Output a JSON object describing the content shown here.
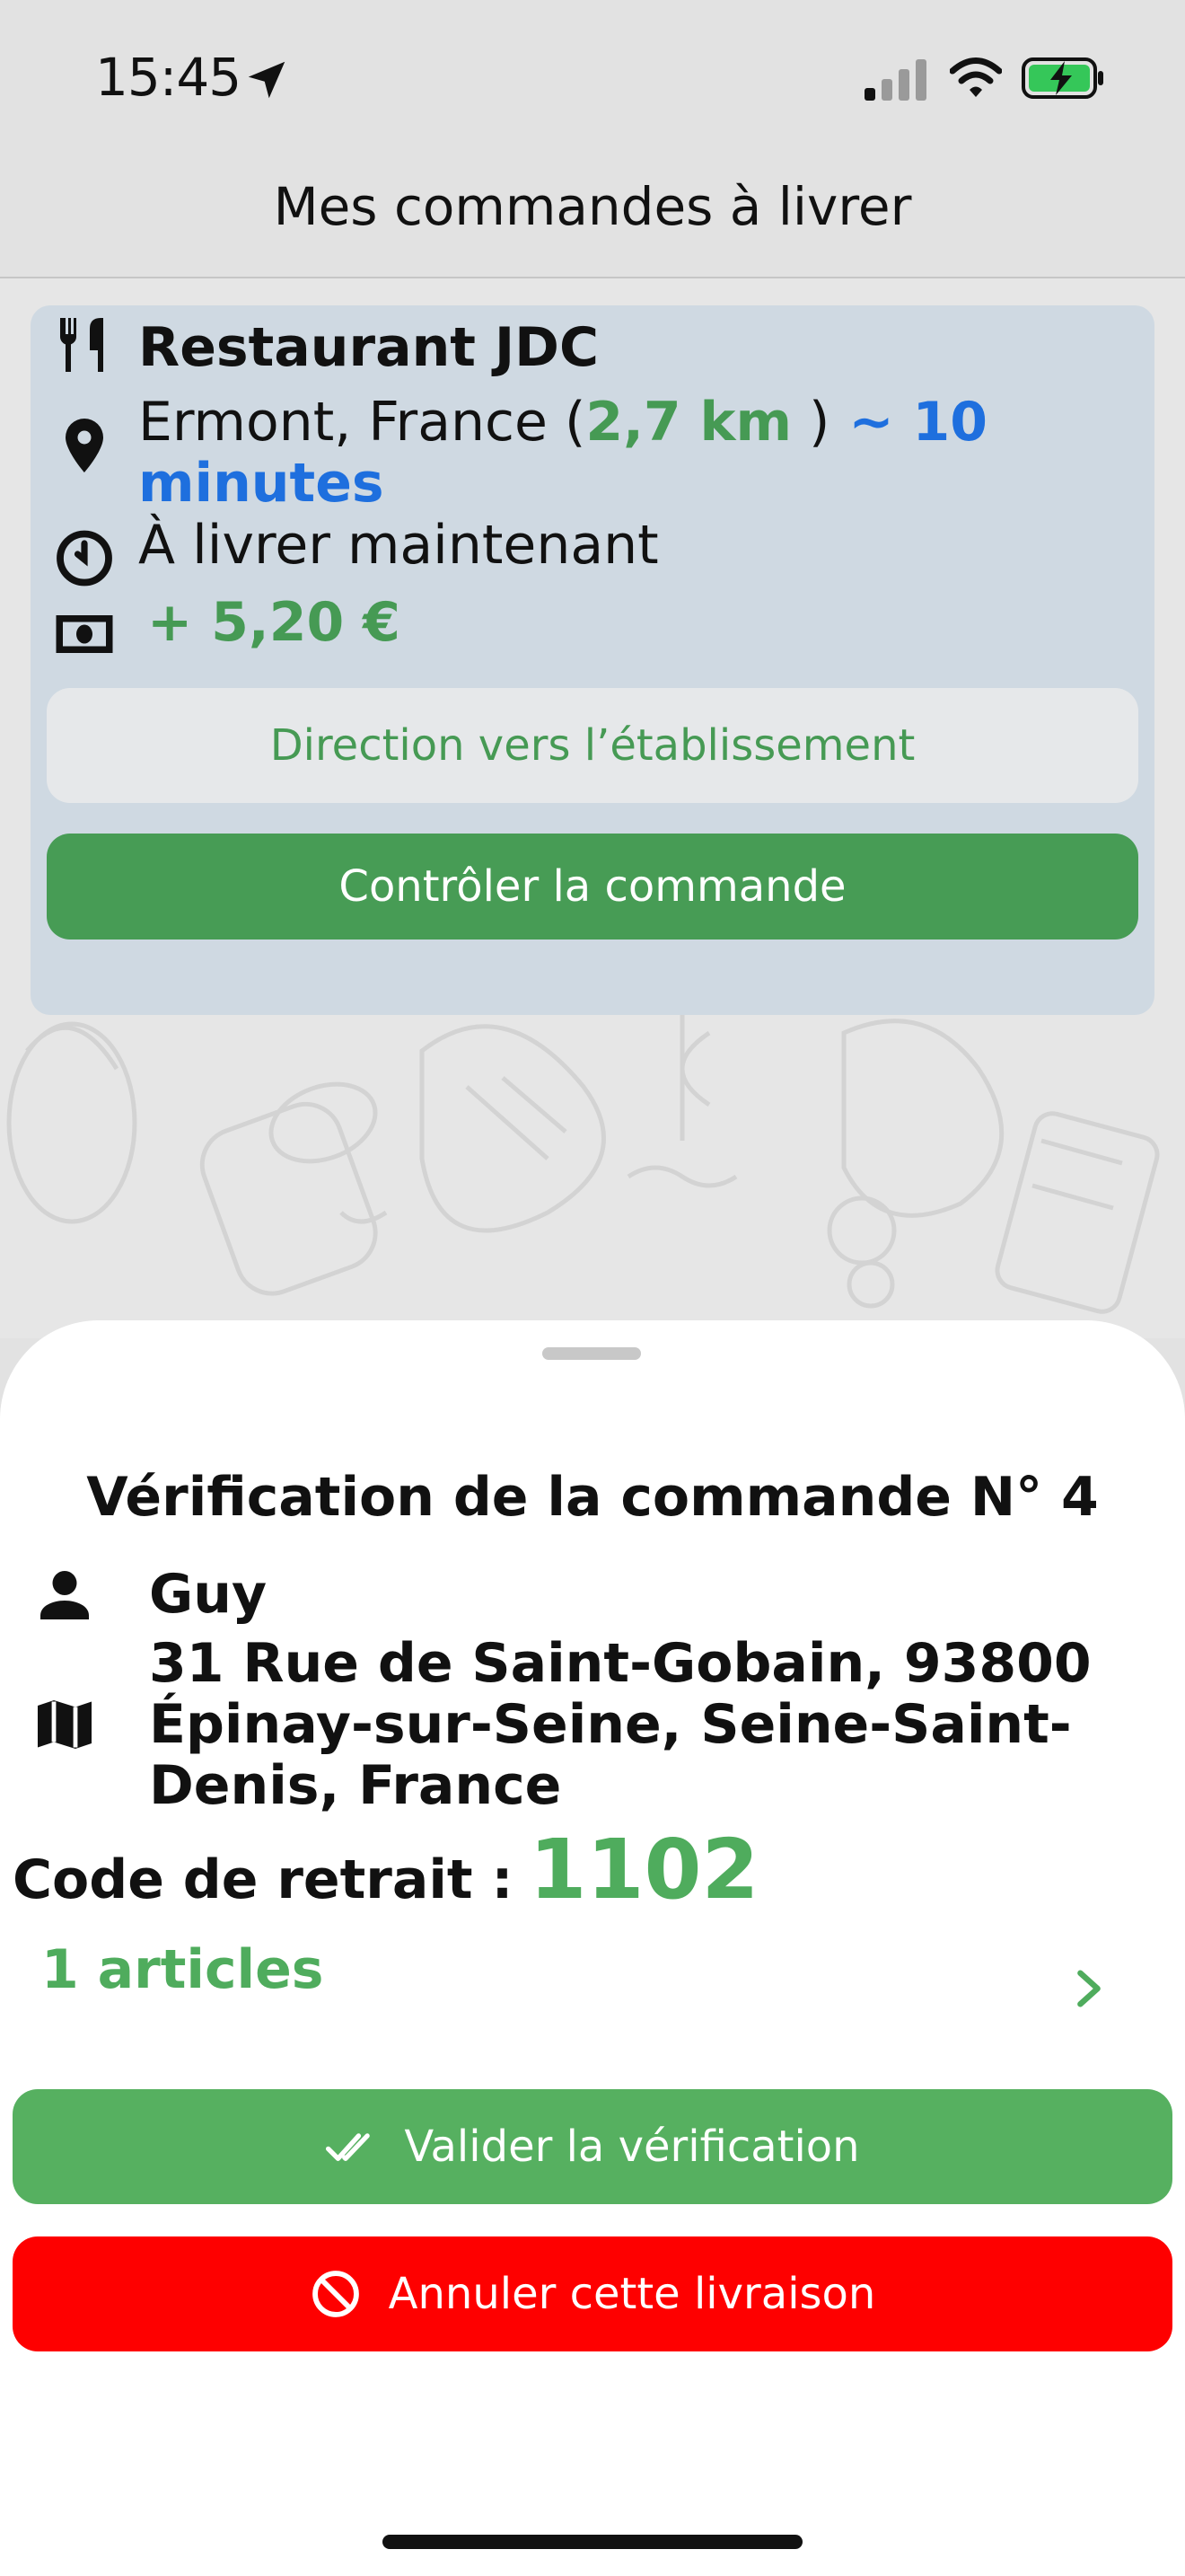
{
  "status_bar": {
    "time": "15:45",
    "icons": [
      "location-arrow-icon",
      "cellular-signal-icon",
      "wifi-icon",
      "battery-charging-icon"
    ]
  },
  "nav": {
    "title": "Mes commandes à livrer"
  },
  "order_card": {
    "restaurant_name": "Restaurant JDC",
    "address_city": "Ermont, France (",
    "distance": "2,7 km",
    "address_sep": " )",
    "duration": " ~ 10 minutes",
    "delivery_time": "À livrer maintenant",
    "earnings": "+ 5,20 €",
    "direction_button": "Direction vers l’établissement",
    "control_button": "Contrôler la commande",
    "icons": [
      "utensils-icon",
      "map-pin-icon",
      "clock-icon",
      "banknote-icon"
    ]
  },
  "verification_sheet": {
    "title": "Vérification de la commande N° 4",
    "customer_name": "Guy",
    "customer_address": "31 Rue de Saint-Gobain, 93800 Épinay-sur-Seine, Seine-Saint-Denis, France",
    "code_label": "Code de retrait :",
    "code_value": "1102",
    "articles": "1 articles",
    "validate_button": "Valider la vérification",
    "cancel_button": "Annuler cette livraison",
    "icons": [
      "person-icon",
      "map-icon",
      "chevron-right-icon",
      "double-check-icon",
      "ban-icon"
    ]
  },
  "colors": {
    "accent_green": "#469a54",
    "button_green": "#56b060",
    "danger_red": "#fe0000",
    "link_blue": "#1e6fde",
    "card_bg": "#cfd9e2"
  }
}
